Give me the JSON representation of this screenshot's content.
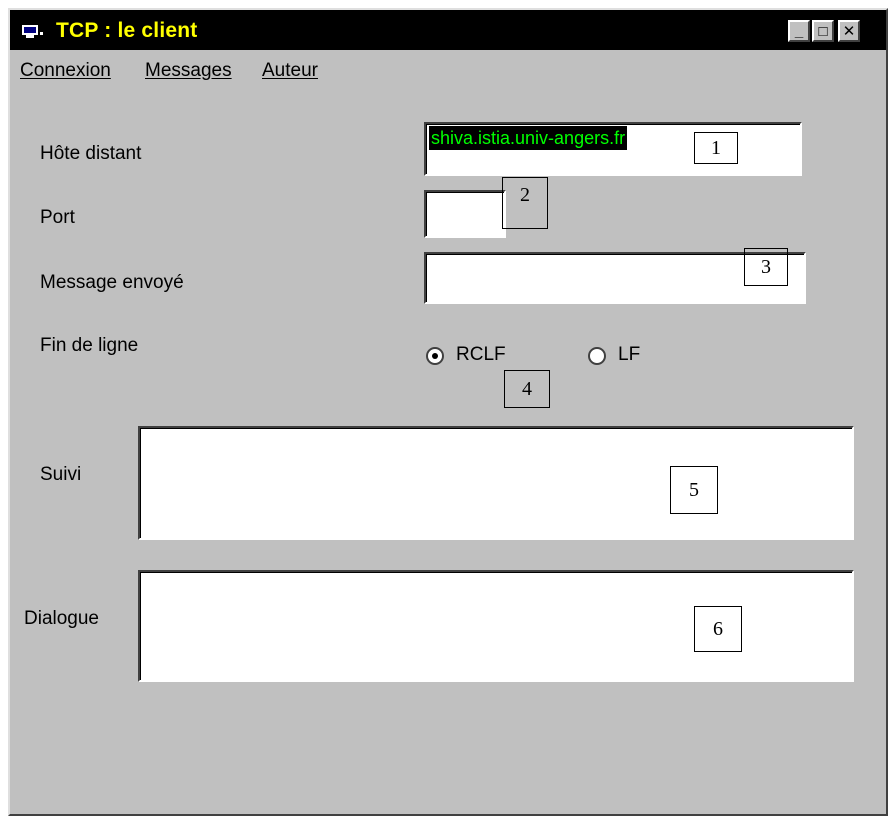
{
  "window": {
    "title": "TCP : le client",
    "controls": {
      "minimize": "_",
      "maximize": "□",
      "close": "✕"
    }
  },
  "menu": [
    "Connexion",
    "Messages",
    "Auteur"
  ],
  "form": {
    "host_label": "Hôte distant",
    "host_value": "shiva.istia.univ-angers.fr",
    "port_label": "Port",
    "port_value": "",
    "message_label": "Message envoyé",
    "message_value": "",
    "eol_label": "Fin de ligne",
    "eol_options": [
      {
        "label": "RCLF",
        "selected": true
      },
      {
        "label": "LF",
        "selected": false
      }
    ],
    "suivi_label": "Suivi",
    "suivi_value": "",
    "dialogue_label": "Dialogue",
    "dialogue_value": ""
  },
  "callouts": [
    "1",
    "2",
    "3",
    "4",
    "5",
    "6"
  ],
  "colors": {
    "selection_bg": "#000000",
    "selection_text": "#00ff00",
    "title_text": "#ffff00"
  }
}
